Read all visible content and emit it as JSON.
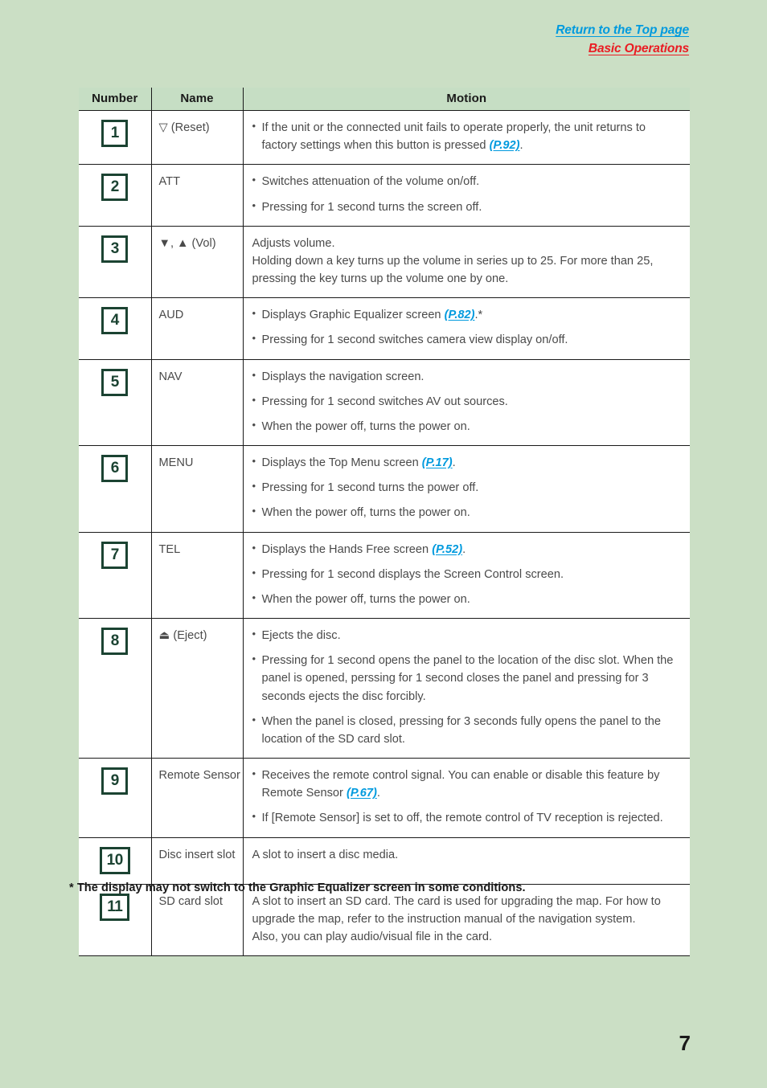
{
  "header": {
    "return_link": "Return to the Top page",
    "section_link": "Basic Operations",
    "return_color": "#009ade",
    "section_color": "#ea1c23"
  },
  "table": {
    "columns": [
      "Number",
      "Name",
      "Motion"
    ],
    "rows": [
      {
        "number": "1",
        "name": "▽ (Reset)",
        "lines": [
          {
            "bullet": true,
            "text": "If the unit or the connected unit fails to operate properly, the unit returns to factory settings when this button is pressed ",
            "ref": "(P.92)",
            "suffix": "."
          }
        ]
      },
      {
        "number": "2",
        "name": "ATT",
        "lines": [
          {
            "bullet": true,
            "text": "Switches attenuation of the volume on/off."
          },
          {
            "bullet": true,
            "text": "Pressing for 1 second turns the screen off."
          }
        ]
      },
      {
        "number": "3",
        "name": "▼, ▲ (Vol)",
        "lines": [
          {
            "bullet": false,
            "text": "Adjusts volume."
          },
          {
            "bullet": false,
            "text": "Holding down a key turns up the volume in series up to 25. For more than 25, pressing the key turns up the volume one by one."
          }
        ]
      },
      {
        "number": "4",
        "name": "AUD",
        "lines": [
          {
            "bullet": true,
            "text": "Displays Graphic Equalizer screen ",
            "ref": "(P.82)",
            "suffix": ".*"
          },
          {
            "bullet": true,
            "text": "Pressing for 1 second switches camera view display on/off."
          }
        ]
      },
      {
        "number": "5",
        "name": "NAV",
        "lines": [
          {
            "bullet": true,
            "text": "Displays the navigation screen."
          },
          {
            "bullet": true,
            "text": "Pressing for 1 second switches AV out sources."
          },
          {
            "bullet": true,
            "text": "When the power off, turns the power on."
          }
        ]
      },
      {
        "number": "6",
        "name": "MENU",
        "lines": [
          {
            "bullet": true,
            "text": "Displays the Top Menu screen ",
            "ref": "(P.17)",
            "suffix": "."
          },
          {
            "bullet": true,
            "text": "Pressing for 1 second turns the power off."
          },
          {
            "bullet": true,
            "text": "When the power off, turns the power on."
          }
        ]
      },
      {
        "number": "7",
        "name": "TEL",
        "lines": [
          {
            "bullet": true,
            "text": "Displays the Hands Free screen ",
            "ref": "(P.52)",
            "suffix": "."
          },
          {
            "bullet": true,
            "text": "Pressing for 1 second displays the Screen Control screen."
          },
          {
            "bullet": true,
            "text": "When the power off, turns the power on."
          }
        ]
      },
      {
        "number": "8",
        "name": "⏏ (Eject)",
        "lines": [
          {
            "bullet": true,
            "text": "Ejects the disc."
          },
          {
            "bullet": true,
            "text": "Pressing for 1 second opens the panel to the location of the disc slot. When the panel is opened, perssing for 1 second closes the panel and pressing for 3 seconds ejects the disc forcibly."
          },
          {
            "bullet": true,
            "text": "When the panel is closed, pressing for 3 seconds fully opens the panel to the location of the SD card slot."
          }
        ]
      },
      {
        "number": "9",
        "name": "Remote Sensor",
        "lines": [
          {
            "bullet": true,
            "text": "Receives the remote control signal. You can enable or disable this feature by Remote Sensor ",
            "ref": "(P.67)",
            "suffix": "."
          },
          {
            "bullet": true,
            "text": "If [Remote Sensor] is set to off, the remote control of TV reception is rejected."
          }
        ]
      },
      {
        "number": "10",
        "name": "Disc insert slot",
        "lines": [
          {
            "bullet": false,
            "text": "A slot to insert a disc media."
          }
        ]
      },
      {
        "number": "11",
        "name": "SD card slot",
        "lines": [
          {
            "bullet": false,
            "text": "A slot to insert an SD card. The card is used for upgrading the map. For how to upgrade the map, refer to the instruction manual of the navigation system."
          },
          {
            "bullet": false,
            "text": "Also, you can play audio/visual file in the card."
          }
        ]
      }
    ]
  },
  "footnote": "* The display may not switch to the Graphic Equalizer screen in some conditions.",
  "page_number": "7",
  "colors": {
    "page_background": "#cbdfc5",
    "table_background": "#ffffff",
    "header_cell_background": "#c6dec4",
    "badge_border": "#1b4332",
    "link": "#009ade",
    "accent_red": "#ea1c23",
    "body_text": "#4a4a4a"
  }
}
